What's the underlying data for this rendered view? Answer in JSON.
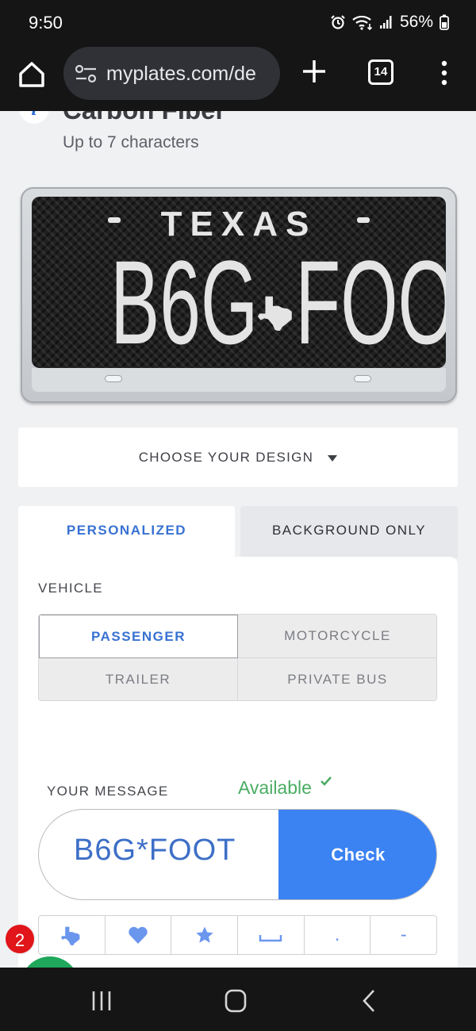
{
  "status_bar": {
    "time": "9:50",
    "battery": "56%"
  },
  "browser": {
    "url": "myplates.com/de",
    "tab_count": "14"
  },
  "design": {
    "title": "Carbon Fiber",
    "subtitle": "Up to 7 characters"
  },
  "plate": {
    "state": "TEXAS",
    "left_text": "B6G",
    "right_text": "FOOT"
  },
  "choose_design": {
    "label": "CHOOSE YOUR DESIGN"
  },
  "tabs": [
    {
      "label": "PERSONALIZED",
      "active": true
    },
    {
      "label": "BACKGROUND ONLY",
      "active": false
    }
  ],
  "vehicle": {
    "label": "VEHICLE",
    "options": [
      {
        "label": "PASSENGER",
        "selected": true
      },
      {
        "label": "MOTORCYCLE",
        "selected": false
      },
      {
        "label": "TRAILER",
        "selected": false
      },
      {
        "label": "PRIVATE BUS",
        "selected": false
      }
    ]
  },
  "message": {
    "label": "YOUR MESSAGE",
    "status": "Available",
    "value": "B6G*FOOT",
    "check_label": "Check"
  },
  "symbols": [
    {
      "name": "texas-icon"
    },
    {
      "name": "heart-icon"
    },
    {
      "name": "star-icon"
    },
    {
      "name": "space-icon"
    },
    {
      "name": "dot",
      "label": "."
    },
    {
      "name": "dash",
      "label": "-"
    }
  ],
  "notification_count": "2",
  "colors": {
    "accent": "#3b82f3",
    "active_text": "#3872d2",
    "available": "#4aad62",
    "badge": "#e0161b"
  }
}
